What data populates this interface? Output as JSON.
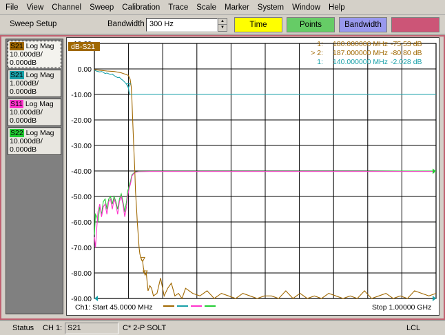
{
  "menu": [
    "File",
    "View",
    "Channel",
    "Sweep",
    "Calibration",
    "Trace",
    "Scale",
    "Marker",
    "System",
    "Window",
    "Help"
  ],
  "toolbar": {
    "setup_label": "Sweep Setup",
    "bandwidth_label": "Bandwidth",
    "bandwidth_value": "300 Hz",
    "buttons": [
      {
        "label": "Time",
        "color": "#ffff00"
      },
      {
        "label": "Points",
        "color": "#66cc66"
      },
      {
        "label": "Bandwidth",
        "color": "#9999ee"
      },
      {
        "label": "",
        "color": "#cc5577"
      }
    ]
  },
  "traces": [
    {
      "tag": "S21",
      "format": "Log Mag",
      "scale": "10.000dB/",
      "ref": "0.000dB",
      "color": "#a06800"
    },
    {
      "tag": "S21",
      "format": "Log Mag",
      "scale": "1.000dB/",
      "ref": "0.000dB",
      "color": "#18a0a8"
    },
    {
      "tag": "S11",
      "format": "Log Mag",
      "scale": "10.000dB/",
      "ref": "0.000dB",
      "color": "#ff33cc"
    },
    {
      "tag": "S22",
      "format": "Log Mag",
      "scale": "10.000dB/",
      "ref": "0.000dB",
      "color": "#22cc33"
    }
  ],
  "chart": {
    "active_trace_label": "dB-S21",
    "start_label": "Ch1: Start  45.0000 MHz",
    "stop_label": "Stop  1.00000 GHz"
  },
  "markers": [
    {
      "id": "1:",
      "freq": "180.000000 MHz",
      "value": "-75.53 dB",
      "color": "#a06800"
    },
    {
      "id": "> 2:",
      "freq": "187.000000 MHz",
      "value": "-80.80 dB",
      "color": "#a06800"
    },
    {
      "id": "1:",
      "freq": "140.000000 MHz",
      "value": "-2.028 dB",
      "color": "#18a0a8"
    }
  ],
  "chart_data": {
    "type": "line",
    "title": "dB-S21",
    "x_start_mhz": 45,
    "x_stop_mhz": 1000,
    "ylim": [
      -90,
      10
    ],
    "yticks": [
      "10.00",
      "0.00",
      "-10.00",
      "-20.00",
      "-30.00",
      "-40.00",
      "-50.00",
      "-60.00",
      "-70.00",
      "-80.00",
      "-90.00"
    ],
    "grid": true,
    "series": [
      {
        "name": "S21",
        "color": "#a06800",
        "x": [
          45,
          60,
          80,
          100,
          120,
          130,
          140,
          145,
          148,
          150,
          152,
          155,
          158,
          160,
          163,
          165,
          168,
          170,
          172,
          175,
          177,
          180,
          182,
          185,
          187,
          190,
          195,
          200,
          205,
          210,
          220,
          230,
          240,
          250,
          260,
          270,
          280,
          290,
          300,
          320,
          340,
          360,
          380,
          400,
          420,
          440,
          460,
          480,
          500,
          520,
          540,
          560,
          580,
          600,
          620,
          640,
          660,
          680,
          700,
          720,
          740,
          760,
          780,
          800,
          820,
          840,
          860,
          880,
          900,
          920,
          940,
          960,
          980,
          1000
        ],
        "y": [
          -0.3,
          -0.5,
          -0.8,
          -1.0,
          -1.5,
          -2.0,
          -2.5,
          -4,
          -7,
          -12,
          -20,
          -30,
          -40,
          -48,
          -55,
          -60,
          -66,
          -70,
          -72.5,
          -74,
          -75,
          -75.5,
          -78,
          -80,
          -80.8,
          -80,
          -87,
          -85,
          -86,
          -89,
          -88,
          -82,
          -89,
          -86,
          -84,
          -89,
          -88,
          -90,
          -86,
          -88,
          -89,
          -87,
          -90,
          -88,
          -89,
          -90,
          -88,
          -89,
          -90,
          -89,
          -89,
          -90,
          -87,
          -90,
          -88,
          -90,
          -89,
          -90,
          -88,
          -89,
          -90,
          -89,
          -90,
          -87,
          -90,
          -89,
          -88,
          -90,
          -89,
          -90,
          -87,
          -88,
          -89,
          -88
        ]
      },
      {
        "name": "S21 (1 dB/div)",
        "color": "#18a0a8",
        "x": [
          45,
          50,
          55,
          60,
          65,
          70,
          75,
          80,
          85,
          90,
          95,
          100,
          105,
          110,
          115,
          120,
          125,
          130,
          135,
          138,
          140,
          142,
          145,
          150,
          200,
          300,
          400,
          500,
          600,
          700,
          800,
          900,
          1000
        ],
        "y": [
          -0.4,
          -0.8,
          -1.0,
          -1.2,
          -1.0,
          -1.3,
          -1.8,
          -1.6,
          -1.9,
          -2.2,
          -2.0,
          -2.6,
          -3.0,
          -3.4,
          -3.3,
          -4.0,
          -4.5,
          -5.2,
          -6.0,
          -6.5,
          -7.4,
          -9.0,
          -10.0,
          -10.0,
          -10.0,
          -10.0,
          -10.0,
          -10.0,
          -10.0,
          -10.0,
          -10.0,
          -10.0,
          -10.0
        ]
      },
      {
        "name": "S11",
        "color": "#ff33cc",
        "x": [
          45,
          48,
          52,
          55,
          60,
          65,
          70,
          75,
          80,
          85,
          90,
          95,
          100,
          105,
          110,
          115,
          120,
          125,
          130,
          135,
          138,
          142,
          146,
          150,
          155,
          160,
          170,
          200,
          300,
          400,
          500,
          600,
          700,
          800,
          900,
          1000
        ],
        "y": [
          -66,
          -70,
          -62,
          -56,
          -53,
          -58,
          -54,
          -53,
          -57,
          -52,
          -51,
          -55,
          -51,
          -53,
          -57,
          -52,
          -50,
          -53,
          -58,
          -54,
          -50,
          -47,
          -45,
          -42,
          -41,
          -40.5,
          -40.3,
          -40.2,
          -40.2,
          -40.2,
          -40.2,
          -40.2,
          -40.2,
          -40.2,
          -40.2,
          -40.2
        ]
      },
      {
        "name": "S22",
        "color": "#22cc33",
        "x": [
          45,
          48,
          52,
          55,
          60,
          65,
          70,
          75,
          80,
          85,
          90,
          95,
          100,
          105,
          110,
          115,
          120,
          125,
          130,
          135,
          138,
          142,
          146,
          150,
          155,
          160,
          170,
          200,
          300,
          400,
          500,
          600,
          700,
          800,
          900,
          1000
        ],
        "y": [
          -65,
          -57,
          -58,
          -60,
          -54,
          -57,
          -52,
          -51,
          -55,
          -51,
          -50,
          -53,
          -50,
          -52,
          -55,
          -51,
          -49,
          -52,
          -56,
          -52,
          -48,
          -46,
          -44,
          -41.5,
          -40.8,
          -40.3,
          -40.1,
          -40.1,
          -40.1,
          -40.1,
          -40.1,
          -40.1,
          -40.1,
          -40.1,
          -40.0,
          -40.0
        ]
      }
    ]
  },
  "status": {
    "label": "Status",
    "channel": "CH 1:",
    "param": "S21",
    "cal": "C* 2-P SOLT",
    "mode": "LCL"
  }
}
